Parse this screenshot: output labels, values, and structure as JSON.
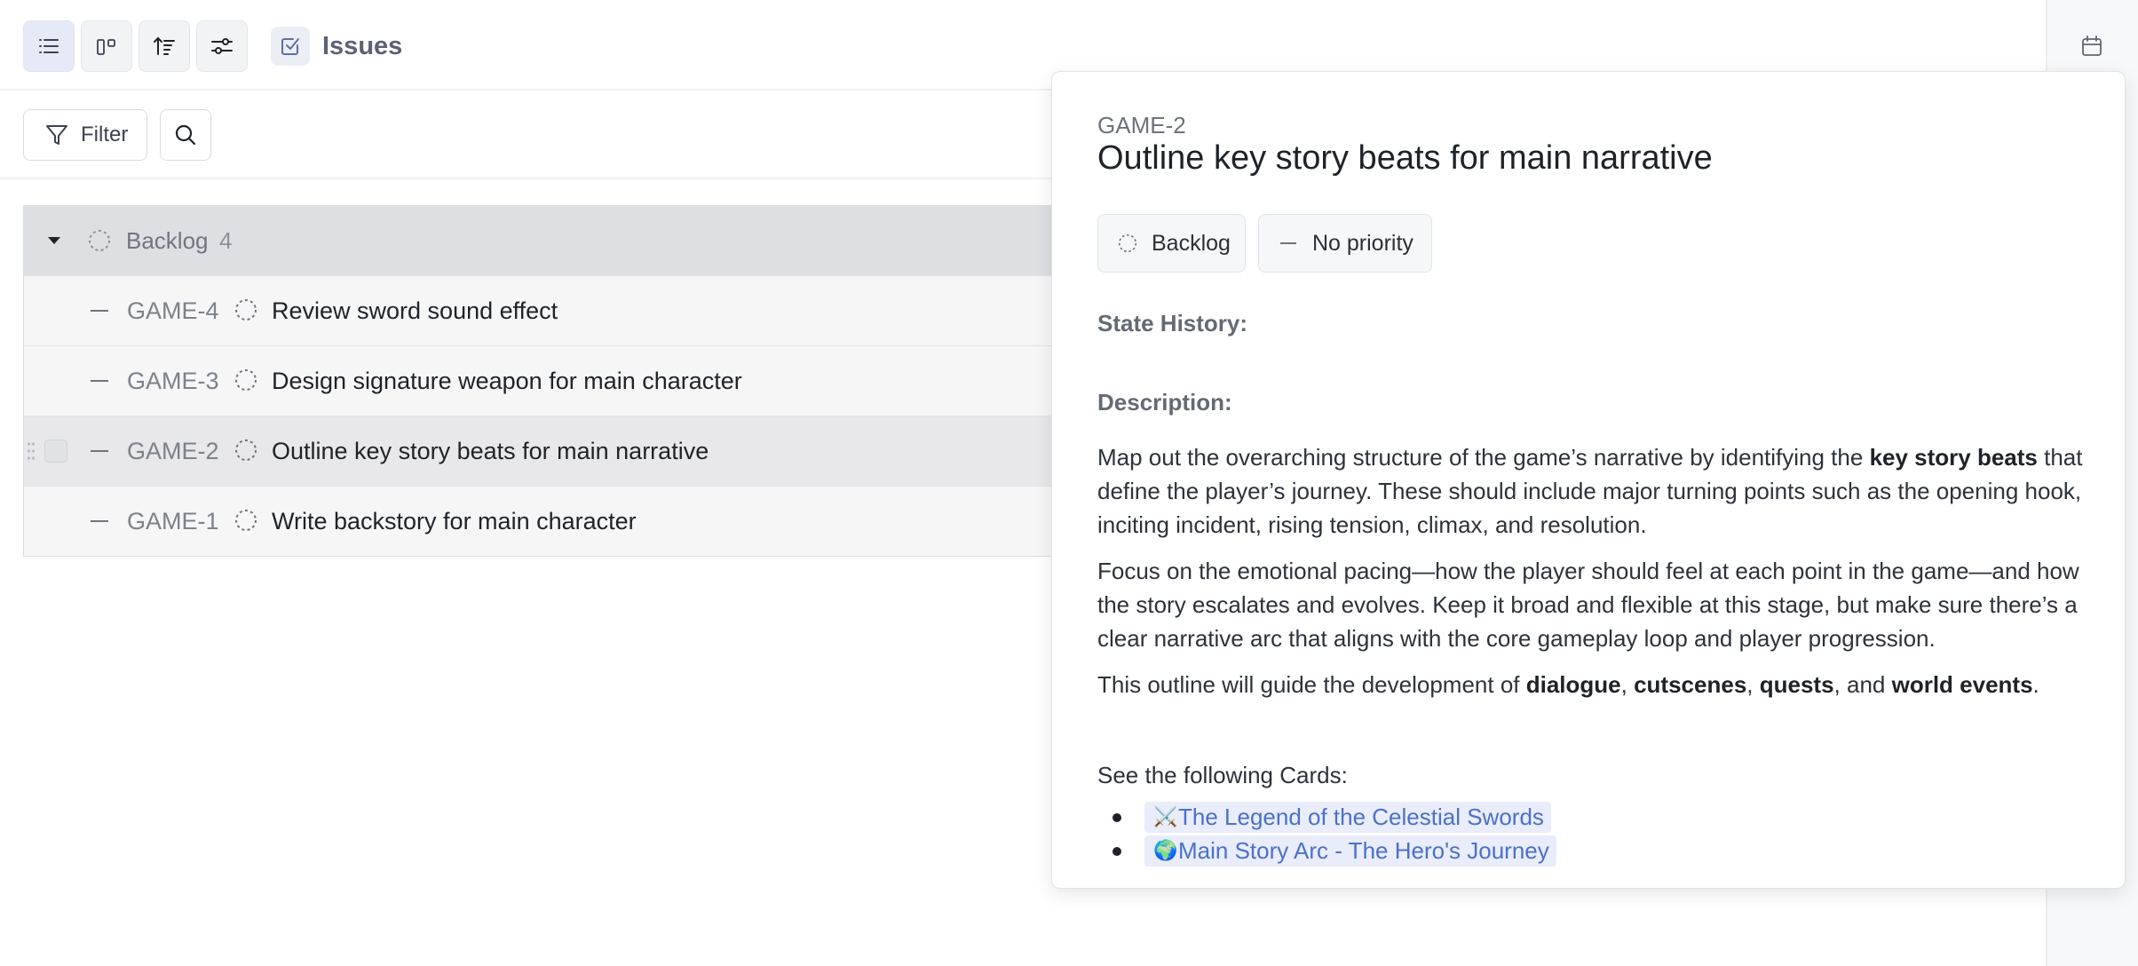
{
  "header": {
    "title": "Issues",
    "view_buttons": [
      "list-view",
      "board-view",
      "sort",
      "settings"
    ]
  },
  "filterbar": {
    "filter_label": "Filter"
  },
  "group": {
    "label": "Backlog",
    "count": "4"
  },
  "issues": [
    {
      "key": "GAME-4",
      "title": "Review sword sound effect"
    },
    {
      "key": "GAME-3",
      "title": "Design signature weapon for main character"
    },
    {
      "key": "GAME-2",
      "title": "Outline key story beats for main narrative"
    },
    {
      "key": "GAME-1",
      "title": "Write backstory for main character"
    }
  ],
  "detail": {
    "key": "GAME-2",
    "title": "Outline key story beats for main narrative",
    "status": "Backlog",
    "priority": "No priority",
    "state_history_label": "State History:",
    "description_label": "Description:",
    "para1_a": "Map out the overarching structure of the game’s narrative by identifying the ",
    "para1_b": "key story beats",
    "para1_c": " that define the player’s journey. These should include major turning points such as the opening hook, inciting incident, rising tension, climax, and resolution.",
    "para2": "Focus on the emotional pacing—how the player should feel at each point in the game—and how the story escalates and evolves. Keep it broad and flexible at this stage, but make sure there’s a clear narrative arc that aligns with the core gameplay loop and player progression.",
    "para3_a": "This outline will guide the development of ",
    "para3_b": "dialogue",
    "para3_c": ", ",
    "para3_d": "cutscenes",
    "para3_e": ", ",
    "para3_f": "quests",
    "para3_g": ", and ",
    "para3_h": "world events",
    "para3_i": ".",
    "cards_label": "See the following Cards:",
    "cards": [
      {
        "emoji": "⚔️",
        "title": "The Legend of the Celestial Swords"
      },
      {
        "emoji": "🌍",
        "title": "Main Story Arc - The Hero's Journey"
      }
    ]
  },
  "colors": {
    "accent_link": "#4a71c8",
    "selected_row": "#e8e8ea",
    "group_header": "#dedfe2"
  }
}
